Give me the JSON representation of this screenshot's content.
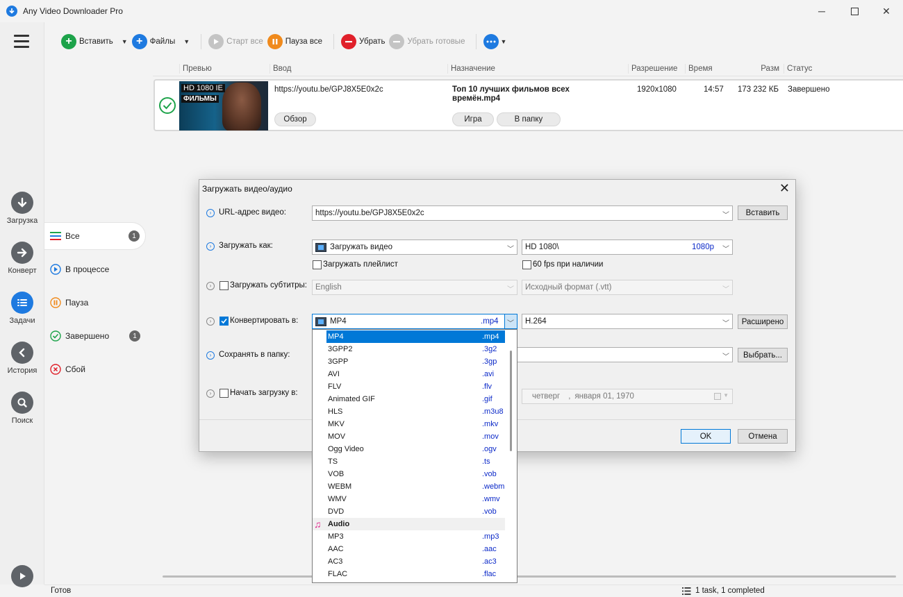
{
  "window": {
    "title": "Any Video Downloader Pro"
  },
  "rail": {
    "items": [
      {
        "label": "Загрузка"
      },
      {
        "label": "Конверт"
      },
      {
        "label": "Задачи"
      },
      {
        "label": "История"
      },
      {
        "label": "Поиск"
      }
    ]
  },
  "filters": [
    {
      "label": "Все",
      "count": "1"
    },
    {
      "label": "В процессе"
    },
    {
      "label": "Пауза"
    },
    {
      "label": "Завершено",
      "count": "1"
    },
    {
      "label": "Сбой"
    }
  ],
  "toolbar": {
    "paste": "Вставить",
    "files": "Файлы",
    "start_all": "Старт все",
    "pause_all": "Пауза все",
    "remove": "Убрать",
    "remove_done": "Убрать готовые"
  },
  "table": {
    "headers": {
      "preview": "Превью",
      "input": "Ввод",
      "destination": "Назначение",
      "resolution": "Разрешение",
      "time": "Время",
      "size": "Разм",
      "status": "Статус"
    },
    "row": {
      "thumb_line1": "HD 1080 IE",
      "thumb_line2": "ФИЛЬМЫ",
      "url": "https://youtu.be/GPJ8X5E0x2c",
      "title_line1": "Топ 10 лучших фильмов всех",
      "title_line2": "времён.mp4",
      "resolution": "1920x1080",
      "time": "14:57",
      "size": "173 232 КБ",
      "status": "Завершено",
      "browse": "Обзор",
      "play": "Игра",
      "to_folder": "В папку"
    }
  },
  "statusbar": {
    "left": "Готов",
    "right": "1 task, 1 completed"
  },
  "dialog": {
    "title": "Загружать видео/аудио",
    "url_label": "URL-адрес видео:",
    "url_value": "https://youtu.be/GPJ8X5E0x2c",
    "paste": "Вставить",
    "download_as_label": "Загружать как:",
    "download_as_value": "Загружать видео",
    "quality_value": "HD 1080\\",
    "quality_tag": "1080p",
    "playlist_label": "Загружать плейлист",
    "fps_label": "60 fps при наличии",
    "subs_label": "Загружать субтитры:",
    "subs_lang": "English",
    "subs_format": "Исходный формат (.vtt)",
    "convert_label": "Конвертировать в:",
    "convert_format": "MP4",
    "convert_ext": ".mp4",
    "codec": "H.264",
    "advanced": "Расширено",
    "save_label": "Сохранять в папку:",
    "choose": "Выбрать...",
    "schedule_label": "Начать загрузку в:",
    "date_day": "четверг",
    "date_sep": ",",
    "date_value": "января  01, 1970",
    "ok": "OK",
    "cancel": "Отмена"
  },
  "formats": {
    "video": [
      {
        "name": "MP4",
        "ext": ".mp4"
      },
      {
        "name": "3GPP2",
        "ext": ".3g2"
      },
      {
        "name": "3GPP",
        "ext": ".3gp"
      },
      {
        "name": "AVI",
        "ext": ".avi"
      },
      {
        "name": "FLV",
        "ext": ".flv"
      },
      {
        "name": "Animated GIF",
        "ext": ".gif"
      },
      {
        "name": "HLS",
        "ext": ".m3u8"
      },
      {
        "name": "MKV",
        "ext": ".mkv"
      },
      {
        "name": "MOV",
        "ext": ".mov"
      },
      {
        "name": "Ogg Video",
        "ext": ".ogv"
      },
      {
        "name": "TS",
        "ext": ".ts"
      },
      {
        "name": "VOB",
        "ext": ".vob"
      },
      {
        "name": "WEBM",
        "ext": ".webm"
      },
      {
        "name": "WMV",
        "ext": ".wmv"
      },
      {
        "name": "DVD",
        "ext": ".vob"
      }
    ],
    "audio_group": "Audio",
    "audio": [
      {
        "name": "MP3",
        "ext": ".mp3"
      },
      {
        "name": "AAC",
        "ext": ".aac"
      },
      {
        "name": "AC3",
        "ext": ".ac3"
      },
      {
        "name": "FLAC",
        "ext": ".flac"
      }
    ]
  },
  "colors": {
    "accent": "#1e7ae0",
    "green": "#1da34a",
    "orange": "#f08a1c",
    "red": "#e0202a",
    "selection": "#0078d7"
  }
}
